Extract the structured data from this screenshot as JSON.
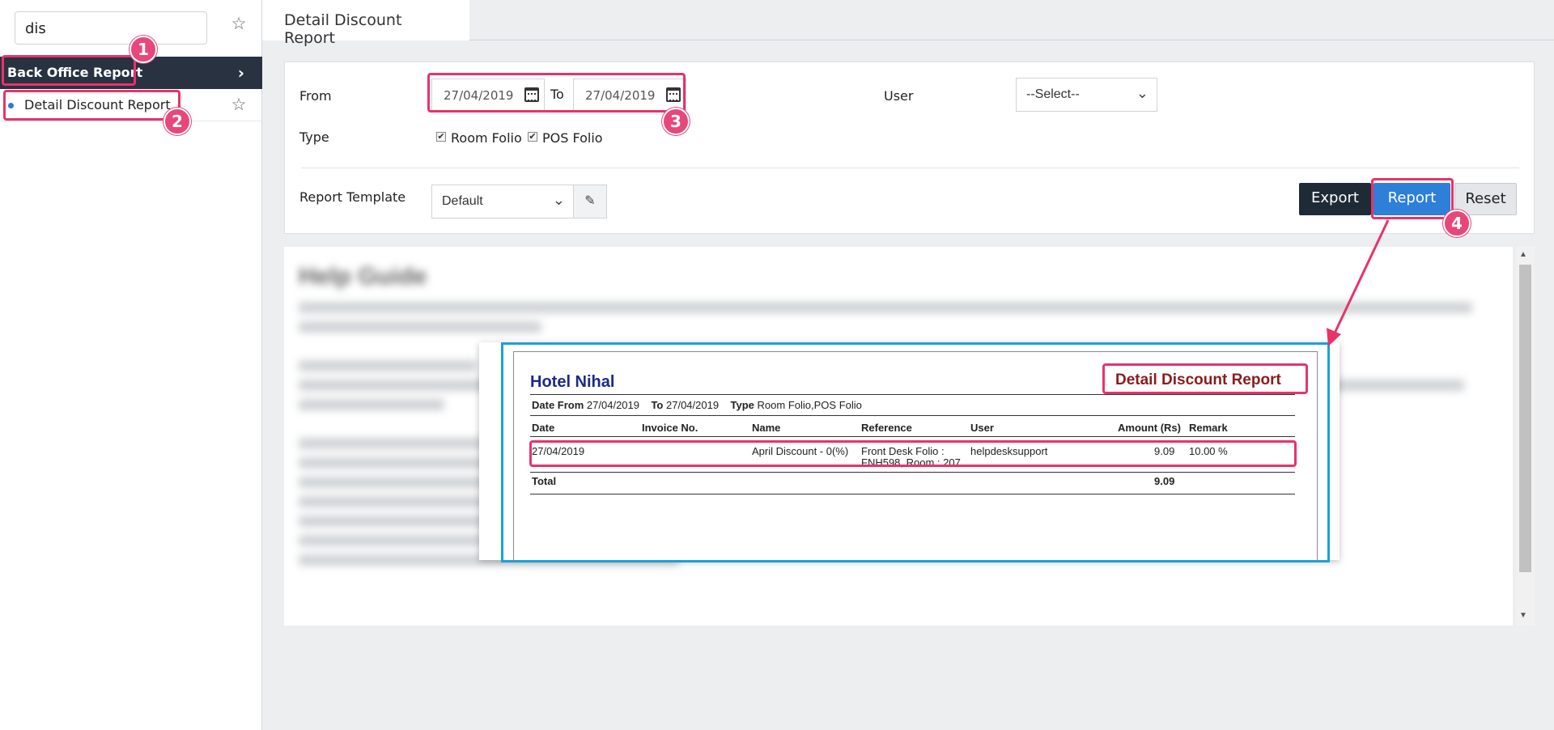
{
  "sidebar": {
    "search_value": "dis",
    "group_label": "Back Office Report",
    "items": [
      {
        "label": "Detail Discount Report"
      }
    ]
  },
  "header": {
    "title": "Detail Discount Report"
  },
  "filters": {
    "from_label": "From",
    "from_date": "27/04/2019",
    "to_label": "To",
    "to_date": "27/04/2019",
    "user_label": "User",
    "user_value": "--Select--",
    "type_label": "Type",
    "type_options": [
      {
        "label": "Room Folio",
        "checked": true
      },
      {
        "label": "POS Folio",
        "checked": true
      }
    ],
    "template_label": "Report Template",
    "template_value": "Default"
  },
  "buttons": {
    "export": "Export",
    "report": "Report",
    "reset": "Reset"
  },
  "help": {
    "title": "Help Guide"
  },
  "report": {
    "hotel_name": "Hotel Nihal",
    "title": "Detail Discount Report",
    "meta": {
      "date_from_label": "Date From",
      "date_from": "27/04/2019",
      "to_label": "To",
      "to": "27/04/2019",
      "type_label": "Type",
      "type": "Room Folio,POS Folio"
    },
    "columns": [
      "Date",
      "Invoice No.",
      "Name",
      "Reference",
      "User",
      "Amount (Rs)",
      "Remark"
    ],
    "rows": [
      {
        "date": "27/04/2019",
        "invoice": "",
        "name": "April Discount - 0(%)",
        "reference_line1": "Front Desk Folio :",
        "reference_line2": "FNH598, Room : 207",
        "user": "helpdesksupport",
        "amount": "9.09",
        "remark": "10.00 %"
      }
    ],
    "total_label": "Total",
    "total_amount": "9.09"
  },
  "annotations": {
    "badges": [
      "1",
      "2",
      "3",
      "4"
    ],
    "highlight_color": "#e8336a",
    "preview_border_color": "#1aa2d8"
  }
}
